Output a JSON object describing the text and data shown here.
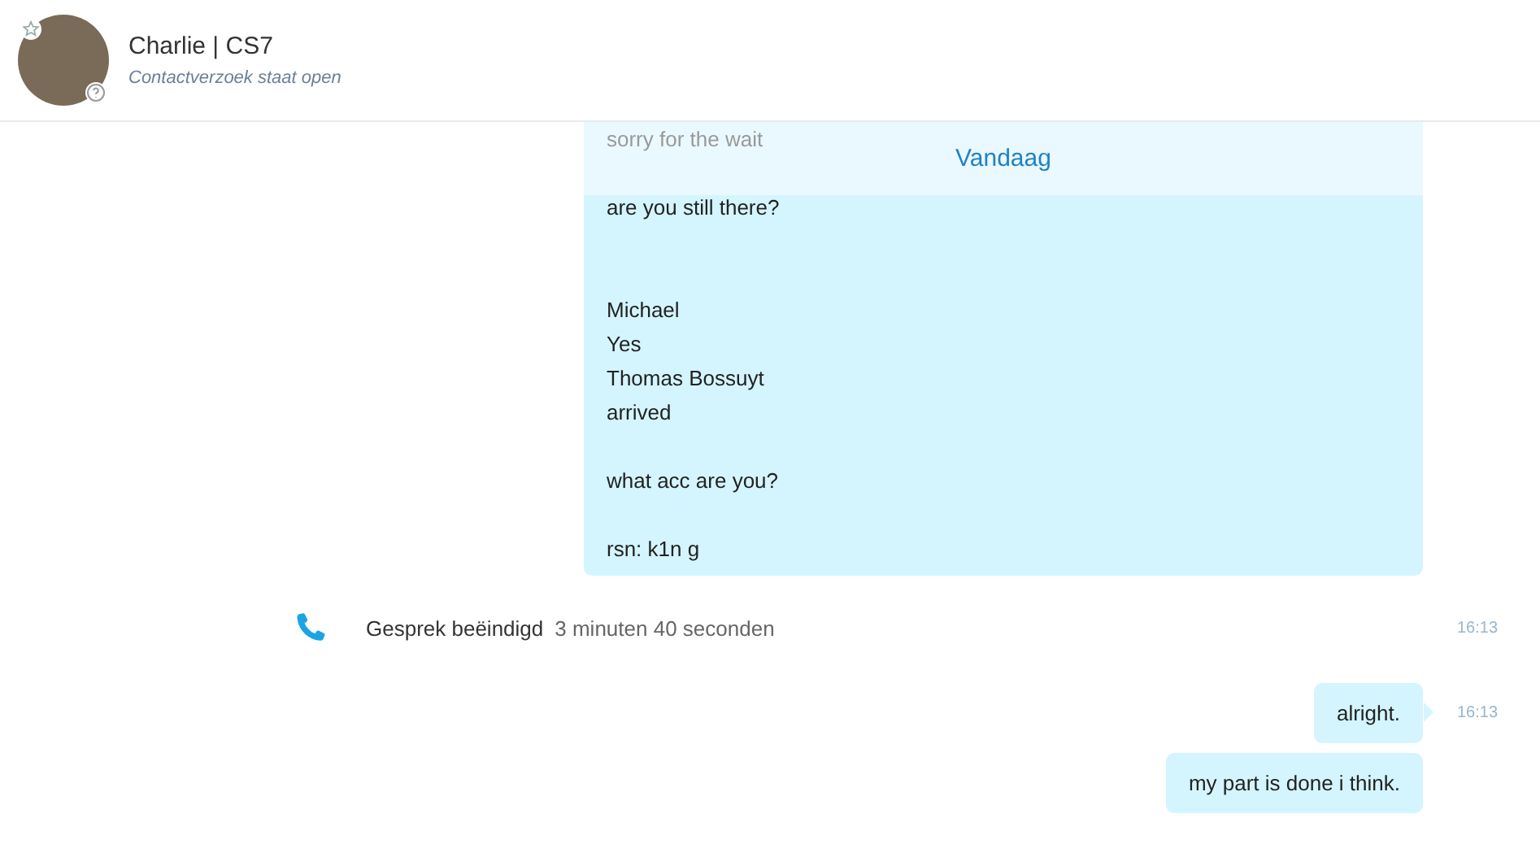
{
  "header": {
    "name": "Charlie | CS7",
    "status": "Contactverzoek staat open"
  },
  "date_divider": "Vandaag",
  "messages": [
    {
      "kind": "bubble",
      "text": "sorry for the wait\n\nare you still there?\n\n\nMichael\nYes\nThomas Bossuyt\narrived\n\nwhat acc are you?\n\nrsn: k1n g",
      "tail": false
    },
    {
      "kind": "call",
      "label": "Gesprek beëindigd",
      "duration": "3 minuten 40 seconden",
      "time": "16:13"
    },
    {
      "kind": "bubble",
      "text": "alright.",
      "time": "16:13",
      "tail": true
    },
    {
      "kind": "bubble",
      "text": "my part is done i think.",
      "tail": false
    }
  ]
}
